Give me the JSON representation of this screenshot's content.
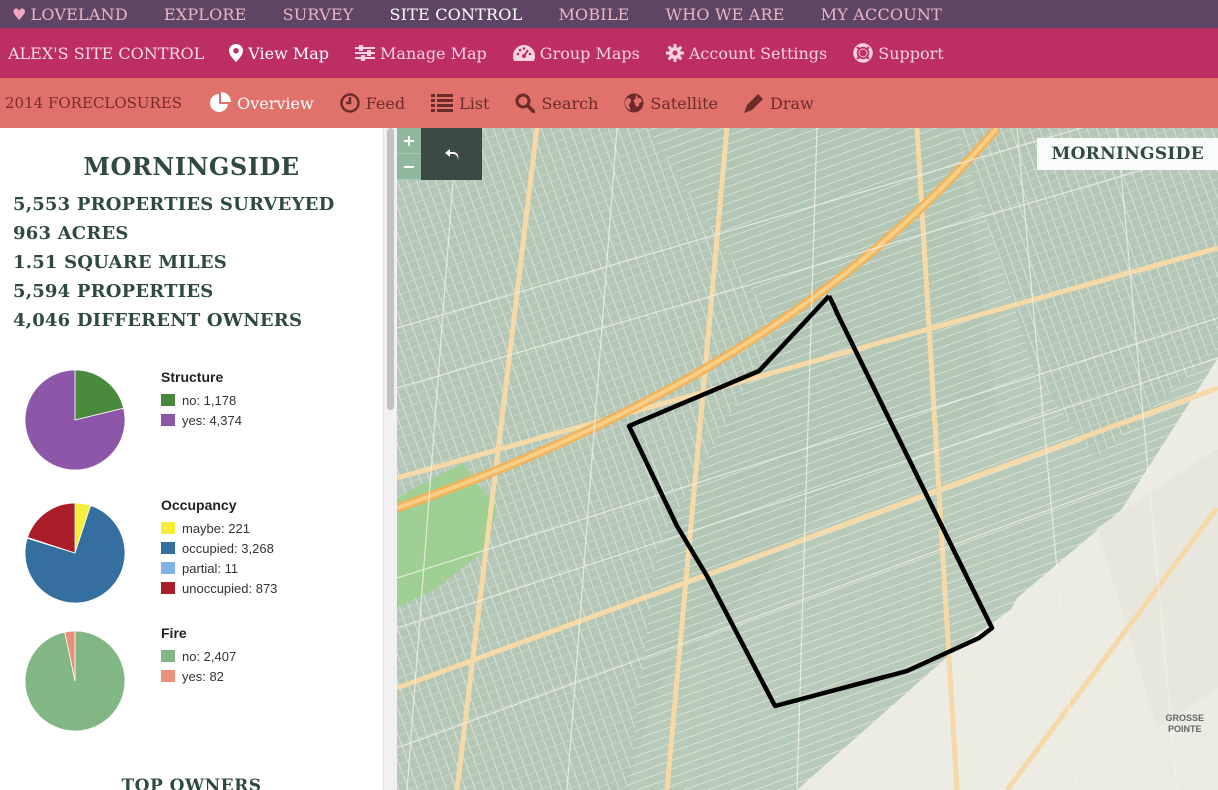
{
  "top_nav": {
    "brand": "LOVELAND",
    "items": [
      "EXPLORE",
      "SURVEY",
      "SITE CONTROL",
      "MOBILE",
      "WHO WE ARE",
      "MY ACCOUNT"
    ],
    "active": "SITE CONTROL"
  },
  "site_nav": {
    "title": "ALEX'S SITE CONTROL",
    "items": [
      {
        "label": "View Map",
        "icon": "map-marker-icon"
      },
      {
        "label": "Manage Map",
        "icon": "sliders-icon"
      },
      {
        "label": "Group Maps",
        "icon": "dashboard-icon"
      },
      {
        "label": "Account Settings",
        "icon": "gear-icon"
      },
      {
        "label": "Support",
        "icon": "life-ring-icon"
      }
    ]
  },
  "survey_nav": {
    "title": "2014 FORECLOSURES",
    "items": [
      {
        "label": "Overview",
        "icon": "pie-chart-icon"
      },
      {
        "label": "Feed",
        "icon": "clock-icon"
      },
      {
        "label": "List",
        "icon": "list-icon"
      },
      {
        "label": "Search",
        "icon": "search-icon"
      },
      {
        "label": "Satellite",
        "icon": "globe-icon"
      },
      {
        "label": "Draw",
        "icon": "pencil-icon"
      }
    ],
    "active": "Overview"
  },
  "sidebar": {
    "area_name": "MORNINGSIDE",
    "stats": [
      "5,553 PROPERTIES SURVEYED",
      "963 ACRES",
      "1.51 SQUARE MILES",
      "5,594 PROPERTIES",
      "4,046 DIFFERENT OWNERS"
    ],
    "next_section": "TOP OWNERS"
  },
  "chart_data": [
    {
      "type": "pie",
      "title": "Structure",
      "labels": [
        "no",
        "yes"
      ],
      "values": [
        1178,
        4374
      ],
      "legend": [
        "no: 1,178",
        "yes: 4,374"
      ],
      "colors": [
        "#4a8a3c",
        "#8d56a8"
      ]
    },
    {
      "type": "pie",
      "title": "Occupancy",
      "labels": [
        "maybe",
        "occupied",
        "partial",
        "unoccupied"
      ],
      "values": [
        221,
        3268,
        11,
        873
      ],
      "legend": [
        "maybe: 221",
        "occupied: 3,268",
        "partial: 11",
        "unoccupied: 873"
      ],
      "colors": [
        "#f5ef3c",
        "#356f9f",
        "#7fb5e6",
        "#aa1e2a"
      ]
    },
    {
      "type": "pie",
      "title": "Fire",
      "labels": [
        "no",
        "yes"
      ],
      "values": [
        2407,
        82
      ],
      "legend": [
        "no: 2,407",
        "yes: 82"
      ],
      "colors": [
        "#80b784",
        "#e9927a"
      ]
    }
  ],
  "map": {
    "label": "MORNINGSIDE",
    "zoom_in": "+",
    "zoom_out": "−",
    "corner_label": [
      "GROSSE",
      "POINTE"
    ]
  }
}
